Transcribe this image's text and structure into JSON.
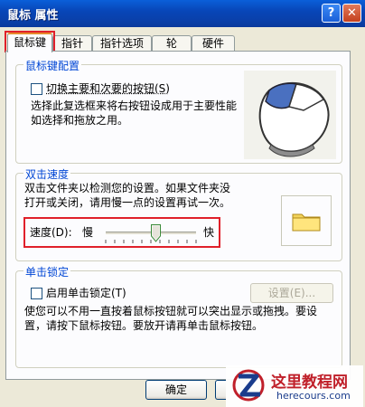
{
  "window": {
    "title": "鼠标 属性",
    "help_label": "?",
    "close_label": "✕"
  },
  "tabs": [
    {
      "label": "鼠标键",
      "active": true
    },
    {
      "label": "指针",
      "active": false
    },
    {
      "label": "指针选项",
      "active": false
    },
    {
      "label": "轮",
      "active": false
    },
    {
      "label": "硬件",
      "active": false
    }
  ],
  "button_config": {
    "title": "鼠标键配置",
    "checkbox_label": "切换主要和次要的按钮(S)",
    "checked": false,
    "description_line1": "选择此复选框来将右按钮设成用于主要性能",
    "description_line2": "如选择和拖放之用。"
  },
  "double_click": {
    "title": "双击速度",
    "description_line1": "双击文件夹以检测您的设置。如果文件夹没",
    "description_line2": "打开或关闭，请用慢一点的设置再试一次。",
    "speed_label": "速度(D):",
    "slow_label": "慢",
    "fast_label": "快",
    "speed_value": 0.55
  },
  "click_lock": {
    "title": "单击锁定",
    "checkbox_label": "启用单击锁定(T)",
    "checked": false,
    "settings_label": "设置(E)...",
    "description_line1": "使您可以不用一直按着鼠标按钮就可以突出显示或拖拽。要设",
    "description_line2": "置，请按下鼠标按钮。要放开请再单击鼠标按钮。"
  },
  "footer": {
    "ok_label": "确定"
  },
  "watermark": {
    "site_name": "这里教程网",
    "site_url": "herecours.com"
  },
  "colors": {
    "accent_red": "#e0202a",
    "group_title": "#0046d5",
    "title_bar": "#0a4fc8"
  }
}
